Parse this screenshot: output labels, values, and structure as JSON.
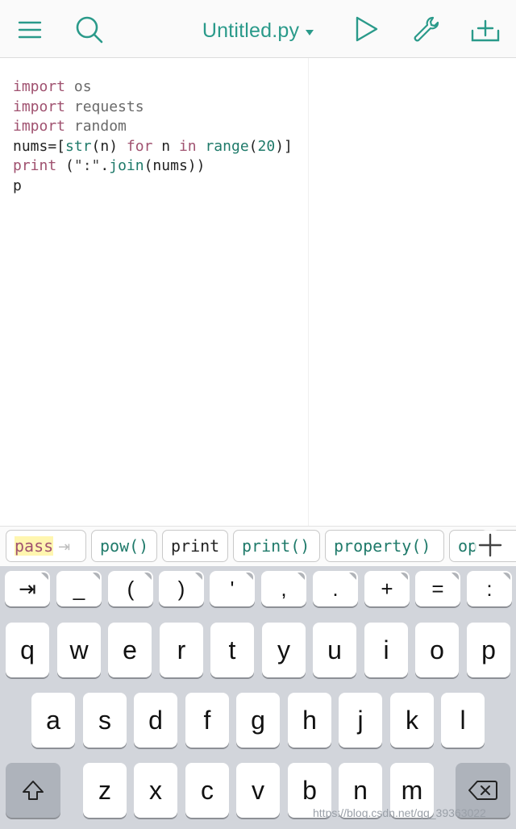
{
  "header": {
    "title": "Untitled.py",
    "icons": [
      "menu-icon",
      "search-icon",
      "run-icon",
      "settings-wrench-icon",
      "add-file-icon"
    ]
  },
  "editor": {
    "lines": [
      [
        {
          "t": "import",
          "c": "kw"
        },
        {
          "t": " os",
          "c": "plain"
        }
      ],
      [
        {
          "t": "import",
          "c": "kw"
        },
        {
          "t": " requests",
          "c": "plain"
        }
      ],
      [
        {
          "t": "import",
          "c": "kw"
        },
        {
          "t": " random",
          "c": "plain"
        }
      ],
      [
        {
          "t": "nums=[",
          "c": "dark"
        },
        {
          "t": "str",
          "c": "fn"
        },
        {
          "t": "(n) ",
          "c": "dark"
        },
        {
          "t": "for",
          "c": "kw"
        },
        {
          "t": " n ",
          "c": "dark"
        },
        {
          "t": "in",
          "c": "kw"
        },
        {
          "t": " ",
          "c": "dark"
        },
        {
          "t": "range",
          "c": "fn"
        },
        {
          "t": "(",
          "c": "dark"
        },
        {
          "t": "20",
          "c": "num"
        },
        {
          "t": ")]",
          "c": "dark"
        }
      ],
      [
        {
          "t": "print",
          "c": "kw"
        },
        {
          "t": " (",
          "c": "dark"
        },
        {
          "t": "\":\"",
          "c": "str"
        },
        {
          "t": ".",
          "c": "dark"
        },
        {
          "t": "join",
          "c": "fn"
        },
        {
          "t": "(nums))",
          "c": "dark"
        }
      ],
      [
        {
          "t": "p",
          "c": "dark"
        }
      ]
    ]
  },
  "suggestions": [
    {
      "label": "pass",
      "kind": "keyword",
      "arrow": "⇥"
    },
    {
      "label": "pow()",
      "kind": "function"
    },
    {
      "label": "print",
      "kind": "plain"
    },
    {
      "label": "print()",
      "kind": "function"
    },
    {
      "label": "property()",
      "kind": "function"
    },
    {
      "label": "op",
      "kind": "function"
    }
  ],
  "keyboard": {
    "symbol_row": [
      "⇥",
      "_",
      "(",
      ")",
      "'",
      ",",
      ".",
      "+",
      "=",
      ":"
    ],
    "row1": [
      "q",
      "w",
      "e",
      "r",
      "t",
      "y",
      "u",
      "i",
      "o",
      "p"
    ],
    "row2": [
      "a",
      "s",
      "d",
      "f",
      "g",
      "h",
      "j",
      "k",
      "l"
    ],
    "row3": [
      "z",
      "x",
      "c",
      "v",
      "b",
      "n",
      "m"
    ],
    "shift_icon": "shift-icon",
    "delete_icon": "backspace-icon"
  },
  "watermark": "https://blog.csdn.net/qq_39363022",
  "colors": {
    "accent": "#2a9a8a",
    "keyword": "#a05270",
    "builtin": "#1f7a6a",
    "keyboard_bg": "#d2d5db"
  }
}
